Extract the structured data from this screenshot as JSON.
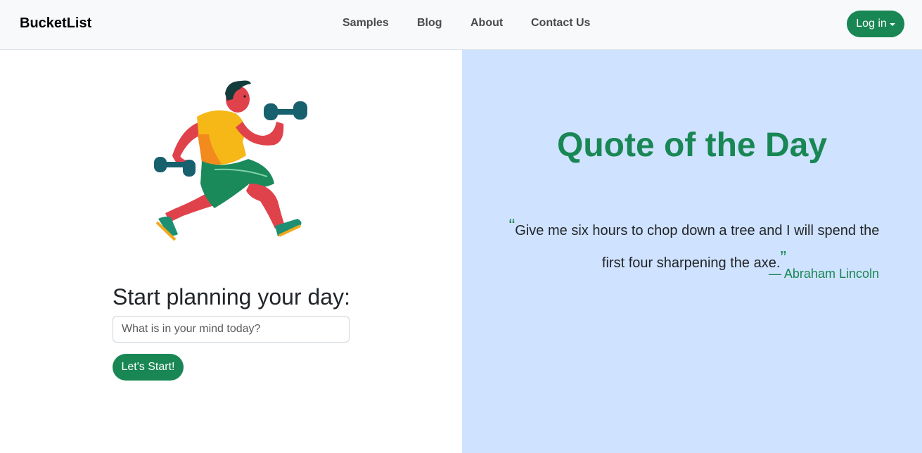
{
  "navbar": {
    "brand": "BucketList",
    "links": [
      "Samples",
      "Blog",
      "About",
      "Contact Us"
    ],
    "login_label": "Log in"
  },
  "planner": {
    "heading": "Start planning your day:",
    "input_placeholder": "What is in your mind today?",
    "start_label": "Let's Start!",
    "illustration_icon": "runner-with-dumbbells-illustration"
  },
  "quote": {
    "title": "Quote of the Day",
    "text": "Give me six hours to chop down a tree and I will spend the first four sharpening the axe.",
    "open_mark": "“",
    "close_mark": "”",
    "author": "— Abraham Lincoln"
  },
  "colors": {
    "accent": "#198754",
    "navbar_bg": "#f8f9fa",
    "quote_bg": "#cfe2ff"
  }
}
